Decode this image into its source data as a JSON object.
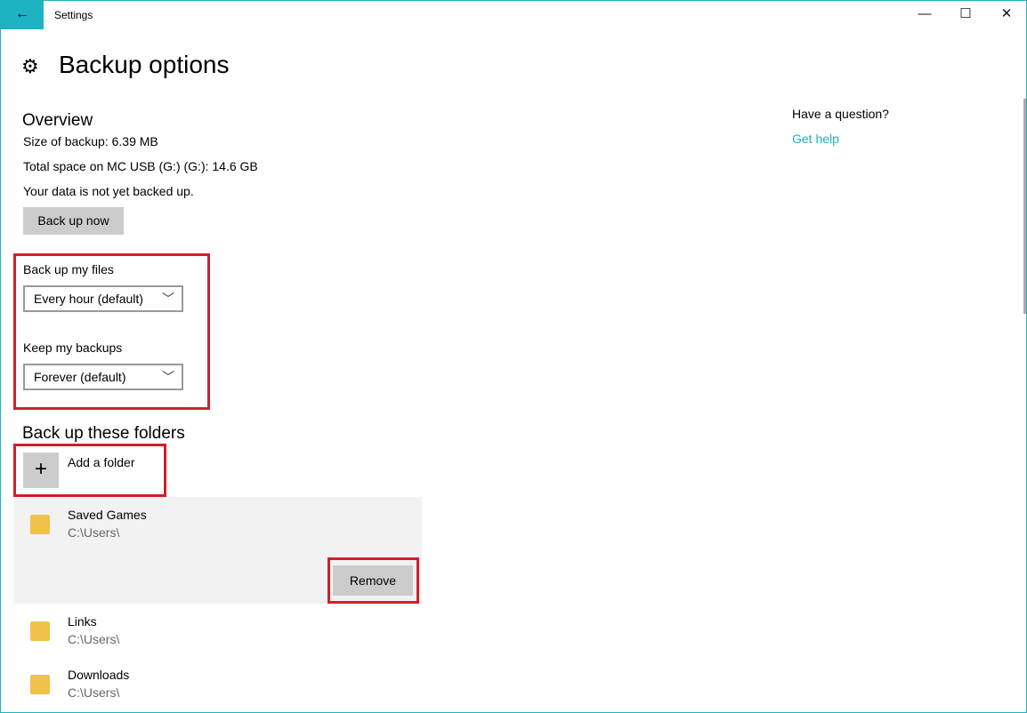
{
  "window": {
    "title": "Settings",
    "back_icon": "←",
    "minimize": "—",
    "maximize": "☐",
    "close": "✕"
  },
  "page": {
    "title": "Backup options",
    "icon": "⚙"
  },
  "overview": {
    "heading": "Overview",
    "size": "Size of backup: 6.39 MB",
    "space": "Total space on MC USB (G:) (G:): 14.6 GB",
    "status": "Your data is not yet backed up.",
    "backup_now": "Back up now"
  },
  "schedule": {
    "files_label": "Back up my files",
    "files_value": "Every hour (default)",
    "keep_label": "Keep my backups",
    "keep_value": "Forever (default)"
  },
  "folders": {
    "heading": "Back up these folders",
    "add_label": "Add a folder",
    "remove": "Remove",
    "items": [
      {
        "name": "Saved Games",
        "path": "C:\\Users\\"
      },
      {
        "name": "Links",
        "path": "C:\\Users\\"
      },
      {
        "name": "Downloads",
        "path": "C:\\Users\\"
      }
    ]
  },
  "help": {
    "question": "Have a question?",
    "link": "Get help"
  },
  "colors": {
    "accent": "#1fb2c2",
    "highlight": "#d01f2b"
  }
}
